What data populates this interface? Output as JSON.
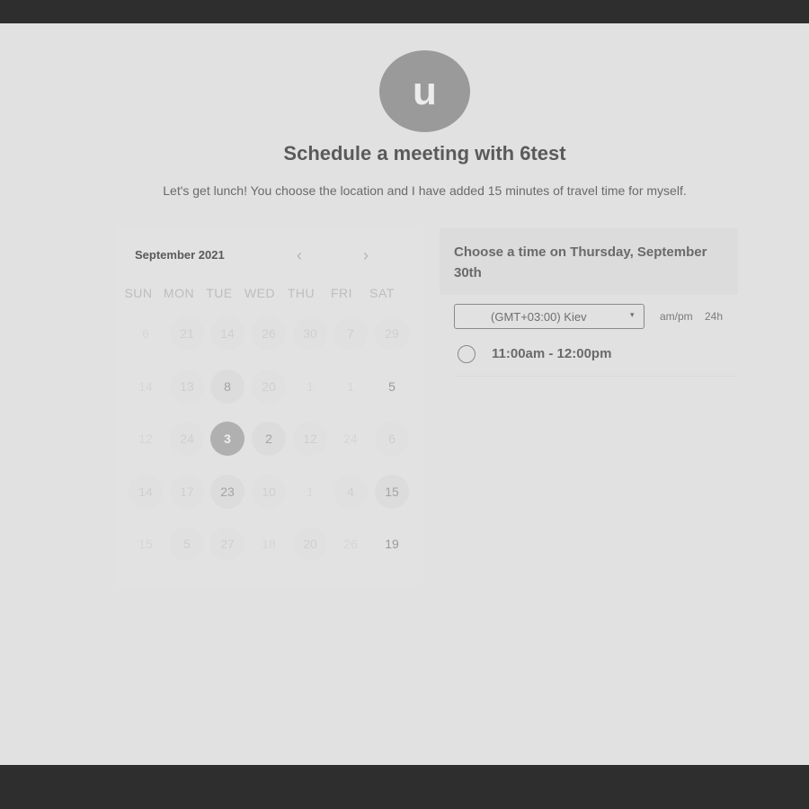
{
  "avatar": {
    "initial": "u"
  },
  "header": {
    "title": "Schedule a meeting with 6test",
    "description": "Let's get lunch! You choose the location and I have added 15 minutes of travel time for myself."
  },
  "calendar": {
    "month_label": "September 2021",
    "prev_icon": "‹",
    "next_icon": "›",
    "weekdays": [
      "SUN",
      "MON",
      "TUE",
      "WED",
      "THU",
      "FRI",
      "SAT"
    ],
    "weeks": [
      [
        "6",
        "21",
        "14",
        "26",
        "30",
        "7",
        "29"
      ],
      [
        "14",
        "13",
        "8",
        "20",
        "1",
        "1",
        "5"
      ],
      [
        "12",
        "24",
        "3",
        "2",
        "12",
        "24",
        "6"
      ],
      [
        "14",
        "17",
        "23",
        "10",
        "1",
        "4",
        "15"
      ],
      [
        "15",
        "5",
        "27",
        "18",
        "20",
        "26",
        "19"
      ]
    ],
    "selected_day": "3"
  },
  "times": {
    "heading": "Choose a time on Thursday, September 30th",
    "timezone": "(GMT+03:00) Kiev",
    "timezone_caret": "▾",
    "format_ampm": "am/pm",
    "format_24h": "24h",
    "slots": [
      "11:00am - 12:00pm"
    ]
  }
}
